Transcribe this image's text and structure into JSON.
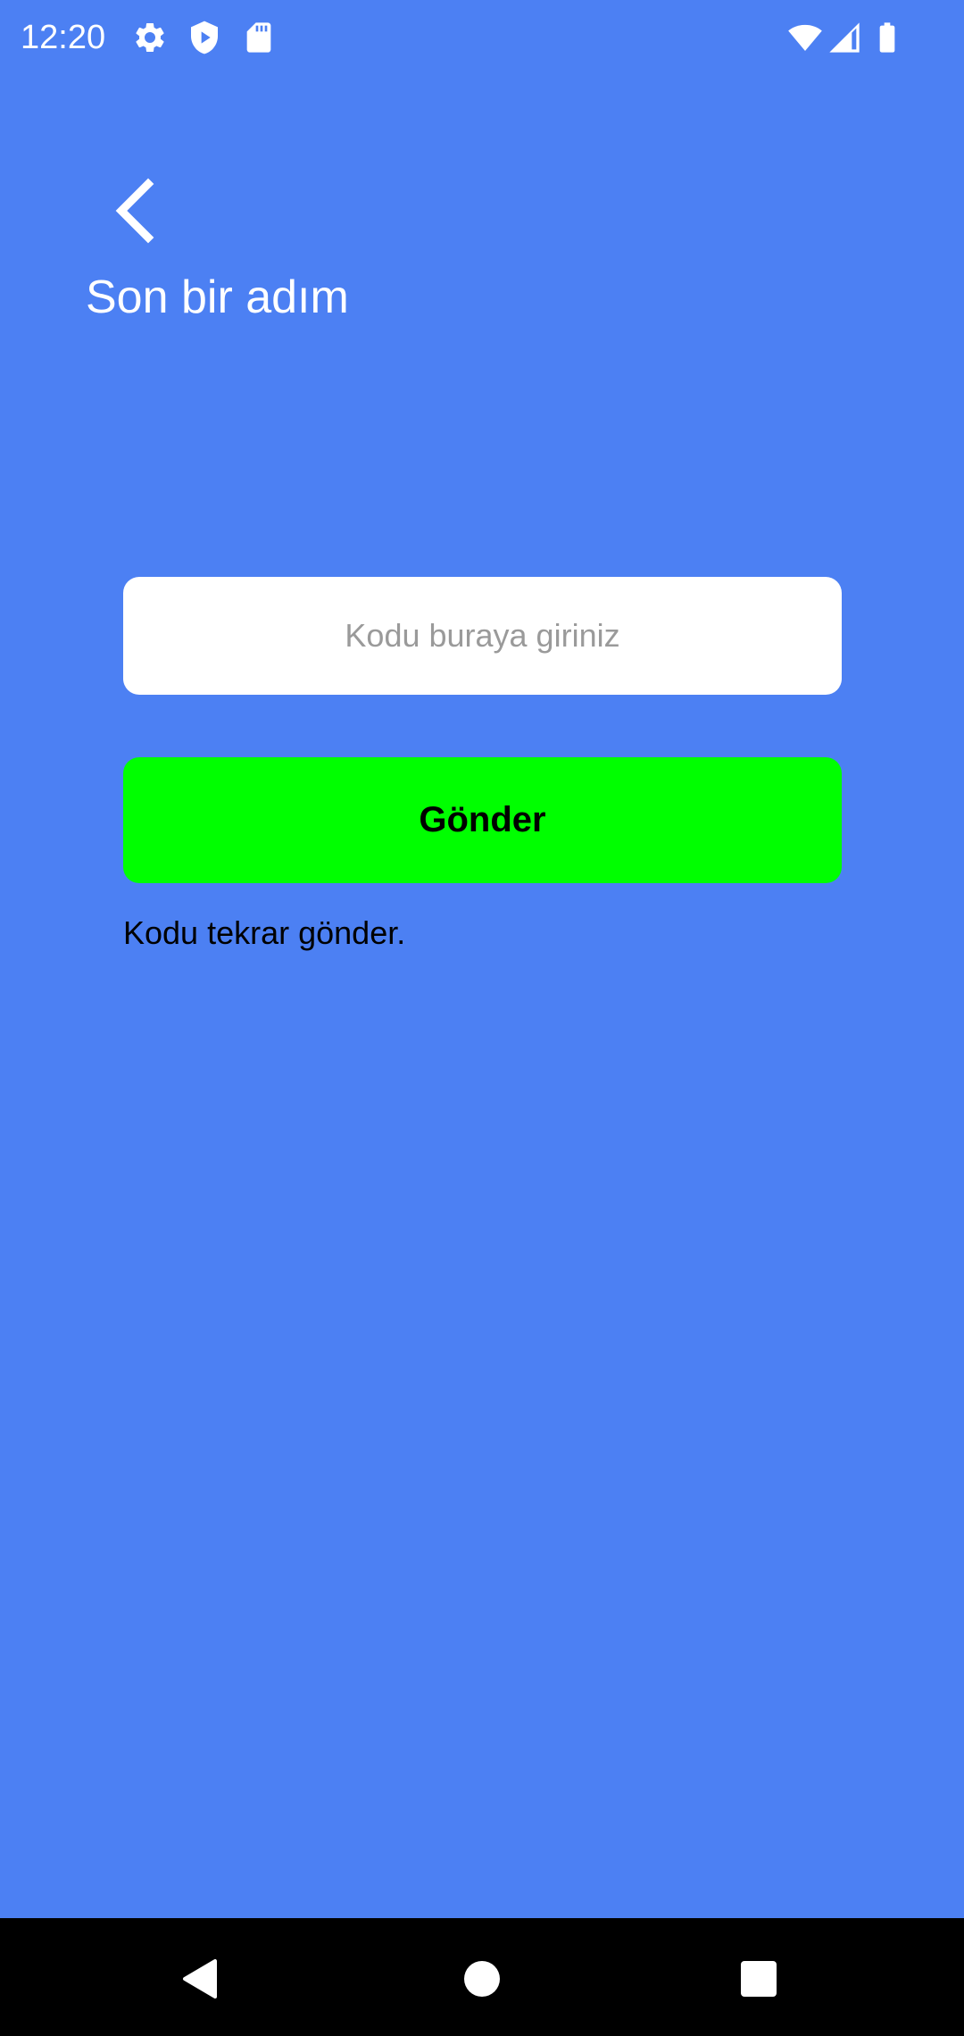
{
  "status_bar": {
    "time": "12:20",
    "left_icons": [
      "gear-icon",
      "shield-play-icon",
      "sd-card-icon"
    ],
    "right_icons": [
      "wifi-icon",
      "cellular-signal-icon",
      "battery-icon"
    ]
  },
  "header": {
    "back_icon": "chevron-left-icon",
    "title": "Son bir adım"
  },
  "form": {
    "code_input": {
      "placeholder": "Kodu buraya giriniz",
      "value": ""
    },
    "submit_label": "Gönder",
    "resend_label": "Kodu tekrar gönder."
  },
  "nav_bar": {
    "icons": [
      "back-triangle-icon",
      "home-circle-icon",
      "recents-square-icon"
    ]
  },
  "colors": {
    "background": "#4C80F3",
    "submit_button": "#00FF00",
    "input_background": "#FFFFFF",
    "nav_bar": "#000000"
  }
}
